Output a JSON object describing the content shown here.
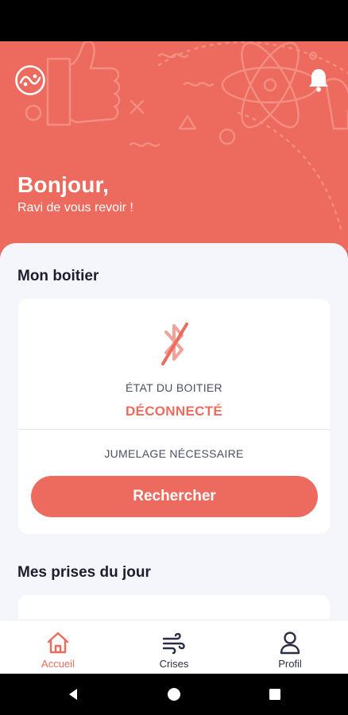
{
  "colors": {
    "accent": "#ec6b5e",
    "background": "#f4f6fb",
    "text_dark": "#1d1d2e"
  },
  "header": {
    "greeting": "Bonjour,",
    "subtitle": "Ravi de vous revoir !",
    "logo_icon": "app-logo-icon",
    "notification_icon": "bell-icon"
  },
  "device": {
    "section_title": "Mon boitier",
    "status_icon": "bluetooth-disabled-icon",
    "state_label": "ÉTAT DU BOITIER",
    "state_value": "DÉCONNECTÉ",
    "pairing_text": "JUMELAGE NÉCESSAIRE",
    "search_button": "Rechercher"
  },
  "intakes": {
    "section_title": "Mes prises du jour"
  },
  "bottom_nav": {
    "items": [
      {
        "label": "Accueil",
        "icon": "home-icon",
        "active": true
      },
      {
        "label": "Crises",
        "icon": "wind-icon",
        "active": false
      },
      {
        "label": "Profil",
        "icon": "user-icon",
        "active": false
      }
    ]
  },
  "system_nav": {
    "back": "back-icon",
    "home": "home-circle-icon",
    "recents": "recents-icon"
  }
}
